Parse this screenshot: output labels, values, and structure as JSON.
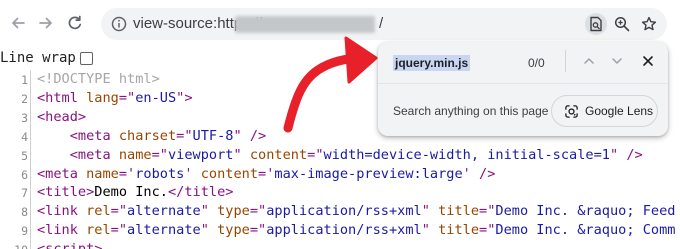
{
  "toolbar": {
    "url_prefix": "view-source:https://",
    "url_suffix": "/"
  },
  "source": {
    "line_wrap_label": "Line wrap",
    "lines": [
      {
        "n": "1",
        "parts": [
          [
            "doctype",
            "<!DOCTYPE html>"
          ]
        ]
      },
      {
        "n": "2",
        "parts": [
          [
            "tag",
            "<html "
          ],
          [
            "attr",
            "lang"
          ],
          [
            "tag",
            "=\""
          ],
          [
            "val",
            "en-US"
          ],
          [
            "tag",
            "\">"
          ]
        ]
      },
      {
        "n": "3",
        "parts": [
          [
            "tag",
            "<head>"
          ]
        ]
      },
      {
        "n": "4",
        "parts": [
          [
            "text",
            "    "
          ],
          [
            "tag",
            "<meta "
          ],
          [
            "attr",
            "charset"
          ],
          [
            "tag",
            "=\""
          ],
          [
            "val",
            "UTF-8"
          ],
          [
            "tag",
            "\" />"
          ]
        ]
      },
      {
        "n": "5",
        "parts": [
          [
            "text",
            "    "
          ],
          [
            "tag",
            "<meta "
          ],
          [
            "attr",
            "name"
          ],
          [
            "tag",
            "=\""
          ],
          [
            "val",
            "viewport"
          ],
          [
            "tag",
            "\" "
          ],
          [
            "attr",
            "content"
          ],
          [
            "tag",
            "=\""
          ],
          [
            "val",
            "width=device-width, initial-scale=1"
          ],
          [
            "tag",
            "\" />"
          ]
        ]
      },
      {
        "n": "6",
        "parts": [
          [
            "tag",
            "<meta "
          ],
          [
            "attr",
            "name"
          ],
          [
            "tag",
            "='"
          ],
          [
            "val",
            "robots"
          ],
          [
            "tag",
            "' "
          ],
          [
            "attr",
            "content"
          ],
          [
            "tag",
            "='"
          ],
          [
            "val",
            "max-image-preview:large"
          ],
          [
            "tag",
            "' />"
          ]
        ]
      },
      {
        "n": "7",
        "parts": [
          [
            "tag",
            "<title>"
          ],
          [
            "text",
            "Demo Inc."
          ],
          [
            "tag",
            "</title>"
          ]
        ]
      },
      {
        "n": "8",
        "parts": [
          [
            "tag",
            "<link "
          ],
          [
            "attr",
            "rel"
          ],
          [
            "tag",
            "=\""
          ],
          [
            "val",
            "alternate"
          ],
          [
            "tag",
            "\" "
          ],
          [
            "attr",
            "type"
          ],
          [
            "tag",
            "=\""
          ],
          [
            "val",
            "application/rss+xml"
          ],
          [
            "tag",
            "\" "
          ],
          [
            "attr",
            "title"
          ],
          [
            "tag",
            "=\""
          ],
          [
            "val",
            "Demo Inc. &raquo; Feed"
          ]
        ]
      },
      {
        "n": "9",
        "parts": [
          [
            "tag",
            "<link "
          ],
          [
            "attr",
            "rel"
          ],
          [
            "tag",
            "=\""
          ],
          [
            "val",
            "alternate"
          ],
          [
            "tag",
            "\" "
          ],
          [
            "attr",
            "type"
          ],
          [
            "tag",
            "=\""
          ],
          [
            "val",
            "application/rss+xml"
          ],
          [
            "tag",
            "\" "
          ],
          [
            "attr",
            "title"
          ],
          [
            "tag",
            "=\""
          ],
          [
            "val",
            "Demo Inc. &raquo; Comm"
          ]
        ]
      },
      {
        "n": "10",
        "parts": [
          [
            "tag",
            "<script>"
          ]
        ]
      }
    ]
  },
  "findbar": {
    "query": "jquery.min.js",
    "count": "0/0",
    "hint": "Search anything on this page",
    "lens_label": "Google Lens"
  },
  "colors": {
    "tag": "#881280",
    "attr": "#994500",
    "value": "#1a1aa6",
    "doctype": "#a6a6a6",
    "arrow": "#e8202a"
  },
  "icons": [
    "back-arrow-icon",
    "forward-arrow-icon",
    "reload-icon",
    "site-info-icon",
    "page-search-icon",
    "zoom-icon",
    "bookmark-star-icon",
    "find-up-icon",
    "find-down-icon",
    "find-close-icon",
    "google-lens-icon",
    "annotation-arrow"
  ]
}
